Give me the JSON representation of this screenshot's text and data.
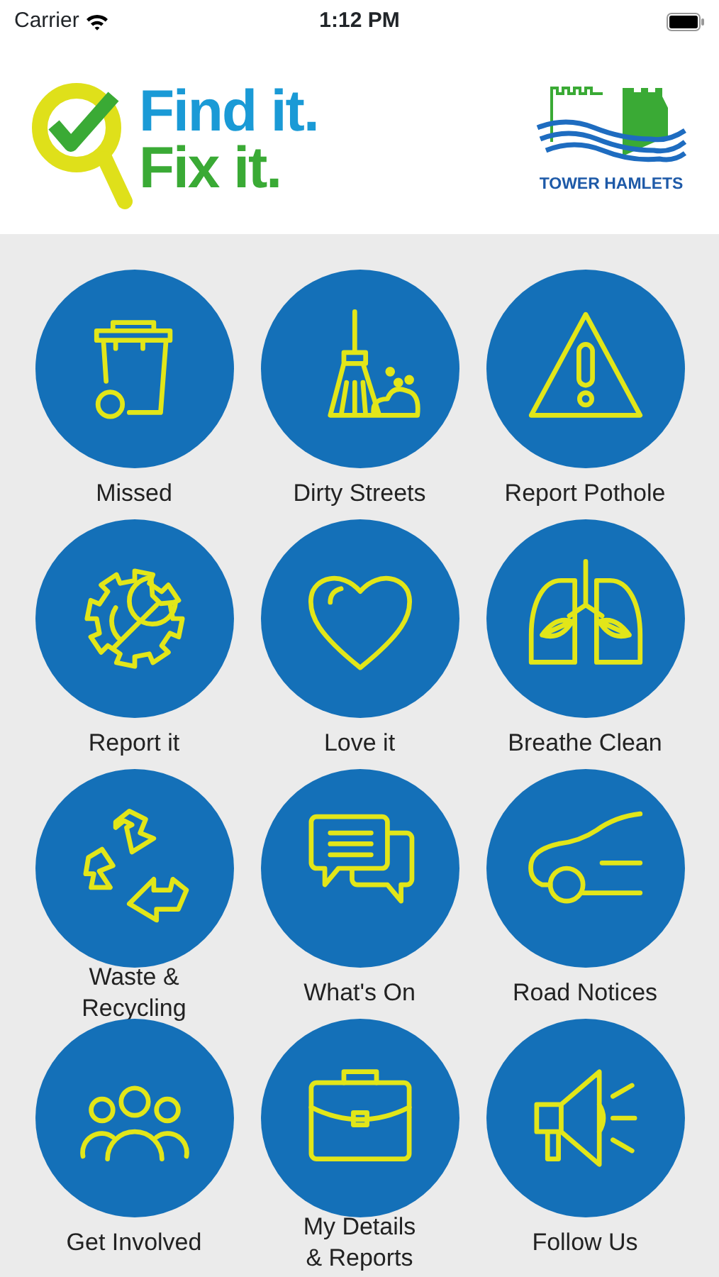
{
  "status_bar": {
    "carrier": "Carrier",
    "time": "1:12 PM"
  },
  "header": {
    "app_logo_lines": [
      "Find it.",
      "Fix it."
    ],
    "council_name": "TOWER HAMLETS"
  },
  "tiles": [
    {
      "label": "Missed"
    },
    {
      "label": "Dirty Streets"
    },
    {
      "label": "Report Pothole"
    },
    {
      "label": "Report it"
    },
    {
      "label": "Love it"
    },
    {
      "label": "Breathe Clean"
    },
    {
      "label": "Waste &\nRecycling"
    },
    {
      "label": "What's On"
    },
    {
      "label": "Road Notices"
    },
    {
      "label": "Get Involved"
    },
    {
      "label": "My Details\n& Reports"
    },
    {
      "label": "Follow Us"
    }
  ]
}
